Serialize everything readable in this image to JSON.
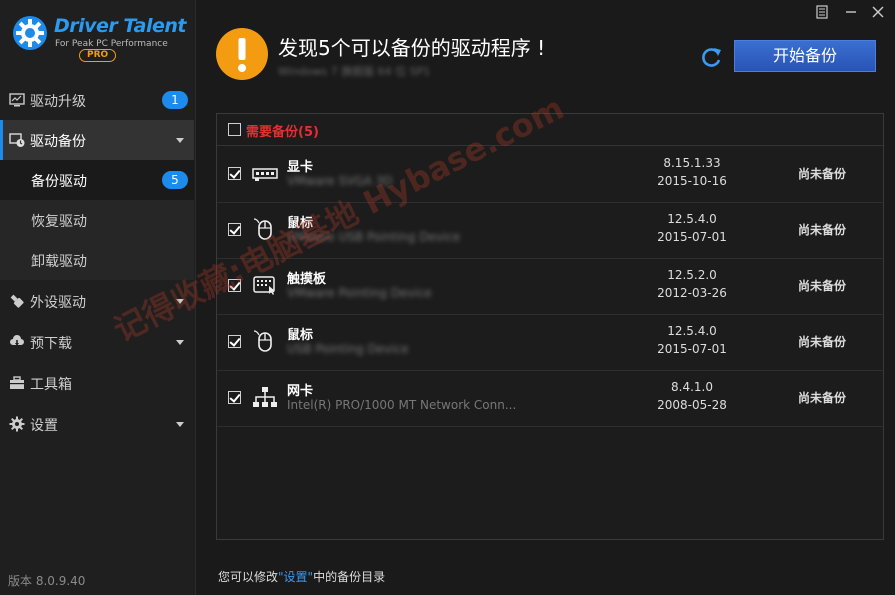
{
  "window": {
    "controls": [
      "menu-icon",
      "minimize-icon",
      "close-icon"
    ]
  },
  "brand": {
    "name": "Driver Talent",
    "tagline": "For Peak PC Performance",
    "edition": "PRO"
  },
  "sidebar": {
    "items": [
      {
        "label": "驱动升级",
        "icon": "monitor-icon",
        "badge": "1"
      },
      {
        "label": "驱动备份",
        "icon": "backup-icon",
        "expanded": true
      },
      {
        "label": "备份驱动",
        "badge": "5"
      },
      {
        "label": "恢复驱动"
      },
      {
        "label": "卸载驱动"
      },
      {
        "label": "外设驱动",
        "icon": "usb-icon"
      },
      {
        "label": "预下载",
        "icon": "cloud-download-icon"
      },
      {
        "label": "工具箱",
        "icon": "toolbox-icon"
      },
      {
        "label": "设置",
        "icon": "gear-icon"
      }
    ],
    "version": "版本 8.0.9.40"
  },
  "header": {
    "headline": "发现5个可以备份的驱动程序 !",
    "os_info": "Windows 7 旗舰版 64 位 SP1",
    "start_button": "开始备份"
  },
  "table": {
    "section_title": "需要备份(5)",
    "rows": [
      {
        "name": "显卡",
        "desc": "VMware SVGA 3D",
        "version": "8.15.1.33",
        "date": "2015-10-16",
        "status": "尚未备份",
        "icon": "graphics-card-icon"
      },
      {
        "name": "鼠标",
        "desc": "VMware USB Pointing Device",
        "version": "12.5.4.0",
        "date": "2015-07-01",
        "status": "尚未备份",
        "icon": "mouse-icon"
      },
      {
        "name": "触摸板",
        "desc": "VMware Pointing Device",
        "version": "12.5.2.0",
        "date": "2012-03-26",
        "status": "尚未备份",
        "icon": "touchpad-icon"
      },
      {
        "name": "鼠标",
        "desc": "USB Pointing Device",
        "version": "12.5.4.0",
        "date": "2015-07-01",
        "status": "尚未备份",
        "icon": "mouse-icon"
      },
      {
        "name": "网卡",
        "desc": "Intel(R) PRO/1000 MT Network Conn...",
        "version": "8.4.1.0",
        "date": "2008-05-28",
        "status": "尚未备份",
        "icon": "network-icon"
      }
    ]
  },
  "footer": {
    "prefix": "您可以修改",
    "link": "\"设置\"",
    "suffix": "中的备份目录"
  },
  "watermark": "记得收藏:电脑基地 Hybase.com",
  "colors": {
    "accent": "#1c8bec",
    "warning": "#f39c12",
    "danger": "#e23030",
    "button": "#3a6fd0"
  }
}
